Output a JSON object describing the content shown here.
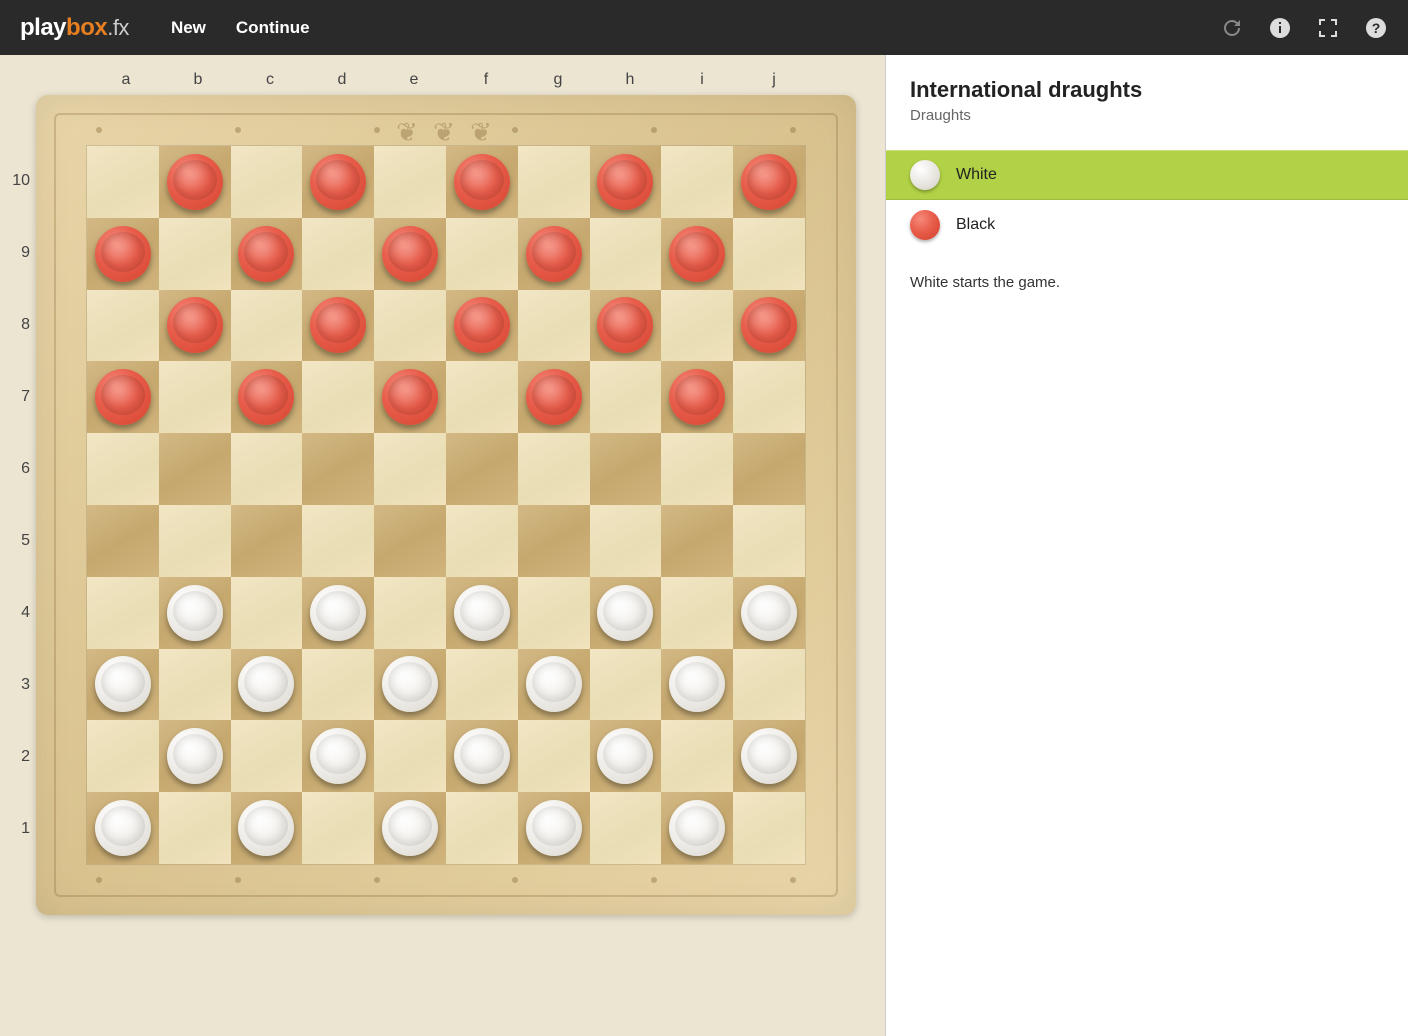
{
  "brand": {
    "part1": "play",
    "part2": "box",
    "part3": ".fx"
  },
  "menu": {
    "new": "New",
    "continue": "Continue"
  },
  "board": {
    "columns": [
      "a",
      "b",
      "c",
      "d",
      "e",
      "f",
      "g",
      "h",
      "i",
      "j"
    ],
    "rows": [
      "10",
      "9",
      "8",
      "7",
      "6",
      "5",
      "4",
      "3",
      "2",
      "1"
    ],
    "pieces": [
      {
        "row": 0,
        "col": 1,
        "color": "red"
      },
      {
        "row": 0,
        "col": 3,
        "color": "red"
      },
      {
        "row": 0,
        "col": 5,
        "color": "red"
      },
      {
        "row": 0,
        "col": 7,
        "color": "red"
      },
      {
        "row": 0,
        "col": 9,
        "color": "red"
      },
      {
        "row": 1,
        "col": 0,
        "color": "red"
      },
      {
        "row": 1,
        "col": 2,
        "color": "red"
      },
      {
        "row": 1,
        "col": 4,
        "color": "red"
      },
      {
        "row": 1,
        "col": 6,
        "color": "red"
      },
      {
        "row": 1,
        "col": 8,
        "color": "red"
      },
      {
        "row": 2,
        "col": 1,
        "color": "red"
      },
      {
        "row": 2,
        "col": 3,
        "color": "red"
      },
      {
        "row": 2,
        "col": 5,
        "color": "red"
      },
      {
        "row": 2,
        "col": 7,
        "color": "red"
      },
      {
        "row": 2,
        "col": 9,
        "color": "red"
      },
      {
        "row": 3,
        "col": 0,
        "color": "red"
      },
      {
        "row": 3,
        "col": 2,
        "color": "red"
      },
      {
        "row": 3,
        "col": 4,
        "color": "red"
      },
      {
        "row": 3,
        "col": 6,
        "color": "red"
      },
      {
        "row": 3,
        "col": 8,
        "color": "red"
      },
      {
        "row": 6,
        "col": 1,
        "color": "white"
      },
      {
        "row": 6,
        "col": 3,
        "color": "white"
      },
      {
        "row": 6,
        "col": 5,
        "color": "white"
      },
      {
        "row": 6,
        "col": 7,
        "color": "white"
      },
      {
        "row": 6,
        "col": 9,
        "color": "white"
      },
      {
        "row": 7,
        "col": 0,
        "color": "white"
      },
      {
        "row": 7,
        "col": 2,
        "color": "white"
      },
      {
        "row": 7,
        "col": 4,
        "color": "white"
      },
      {
        "row": 7,
        "col": 6,
        "color": "white"
      },
      {
        "row": 7,
        "col": 8,
        "color": "white"
      },
      {
        "row": 8,
        "col": 1,
        "color": "white"
      },
      {
        "row": 8,
        "col": 3,
        "color": "white"
      },
      {
        "row": 8,
        "col": 5,
        "color": "white"
      },
      {
        "row": 8,
        "col": 7,
        "color": "white"
      },
      {
        "row": 8,
        "col": 9,
        "color": "white"
      },
      {
        "row": 9,
        "col": 0,
        "color": "white"
      },
      {
        "row": 9,
        "col": 2,
        "color": "white"
      },
      {
        "row": 9,
        "col": 4,
        "color": "white"
      },
      {
        "row": 9,
        "col": 6,
        "color": "white"
      },
      {
        "row": 9,
        "col": 8,
        "color": "white"
      }
    ]
  },
  "sidebar": {
    "title": "International draughts",
    "subtitle": "Draughts",
    "players": [
      {
        "name": "White",
        "color": "w",
        "active": true
      },
      {
        "name": "Black",
        "color": "r",
        "active": false
      }
    ],
    "status": "White starts the game."
  }
}
